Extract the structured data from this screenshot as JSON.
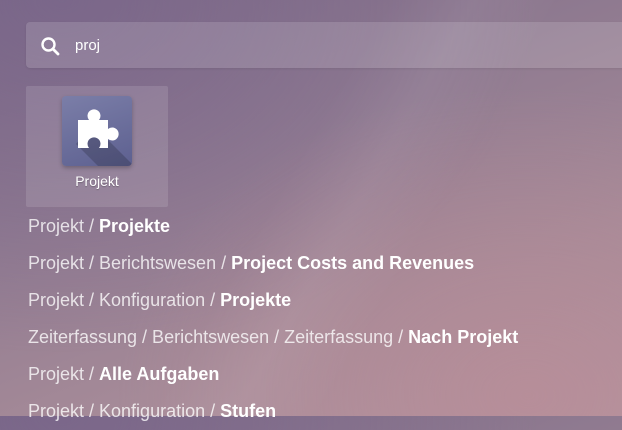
{
  "search": {
    "value": "proj",
    "icon": "search-icon"
  },
  "apps": [
    {
      "label": "Projekt",
      "icon": "puzzle-piece-icon",
      "color": "#6a6d9b"
    }
  ],
  "menu_results": [
    {
      "path": "Projekt / ",
      "target": "Projekte"
    },
    {
      "path": "Projekt / Berichtswesen / ",
      "target": "Project Costs and Revenues"
    },
    {
      "path": "Projekt / Konfiguration / ",
      "target": "Projekte"
    },
    {
      "path": "Zeiterfassung / Berichtswesen / Zeiterfassung / ",
      "target": "Nach Projekt"
    },
    {
      "path": "Projekt / ",
      "target": "Alle Aufgaben"
    },
    {
      "path": "Projekt / Konfiguration / ",
      "target": "Stufen"
    }
  ]
}
